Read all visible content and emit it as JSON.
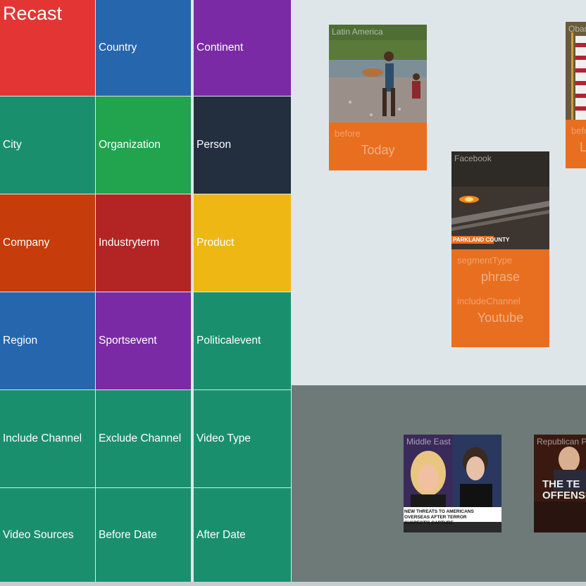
{
  "app": {
    "title": "Recast"
  },
  "tiles": [
    {
      "label": "Country",
      "color": "#2566ad"
    },
    {
      "label": "Continent",
      "color": "#7a2aa4"
    },
    {
      "label": "City",
      "color": "#1a8f6e"
    },
    {
      "label": "Organization",
      "color": "#22a34e"
    },
    {
      "label": "Person",
      "color": "#232e3f"
    },
    {
      "label": "Company",
      "color": "#c63c0b"
    },
    {
      "label": "Industryterm",
      "color": "#b32424"
    },
    {
      "label": "Product",
      "color": "#eeb714"
    },
    {
      "label": "Region",
      "color": "#2566ad"
    },
    {
      "label": "Sportsevent",
      "color": "#7a2aa4"
    },
    {
      "label": "Politicalevent",
      "color": "#1a8f6e"
    },
    {
      "label": "Include Channel",
      "color": "#1a8f6e"
    },
    {
      "label": "Exclude Channel",
      "color": "#1a8f6e"
    },
    {
      "label": "Video Type",
      "color": "#1a8f6e"
    },
    {
      "label": "Video Sources",
      "color": "#1a8f6e"
    },
    {
      "label": "Before Date",
      "color": "#1a8f6e"
    },
    {
      "label": "After Date",
      "color": "#1a8f6e"
    }
  ],
  "title_color": "#e33634",
  "cards": {
    "latin": {
      "caption": "Latin America",
      "k1": "before",
      "v1": "Today"
    },
    "facebook": {
      "caption": "Facebook",
      "overlay": "PARKLAND COUNTY",
      "k1": "segmentType",
      "v1": "phrase",
      "k2": "includeChannel",
      "v2": "Youtube"
    },
    "obama": {
      "caption": "Obama",
      "k1": "before",
      "v1": "L"
    }
  },
  "videos": {
    "middle_east": {
      "caption": "Middle East",
      "ticker": "NEW THREATS TO AMERICANS OVERSEAS AFTER TERROR SUSPECT'S CAPTURE"
    },
    "republican": {
      "caption": "Republican P",
      "overlay": "THE TE OFFENSIV"
    }
  }
}
